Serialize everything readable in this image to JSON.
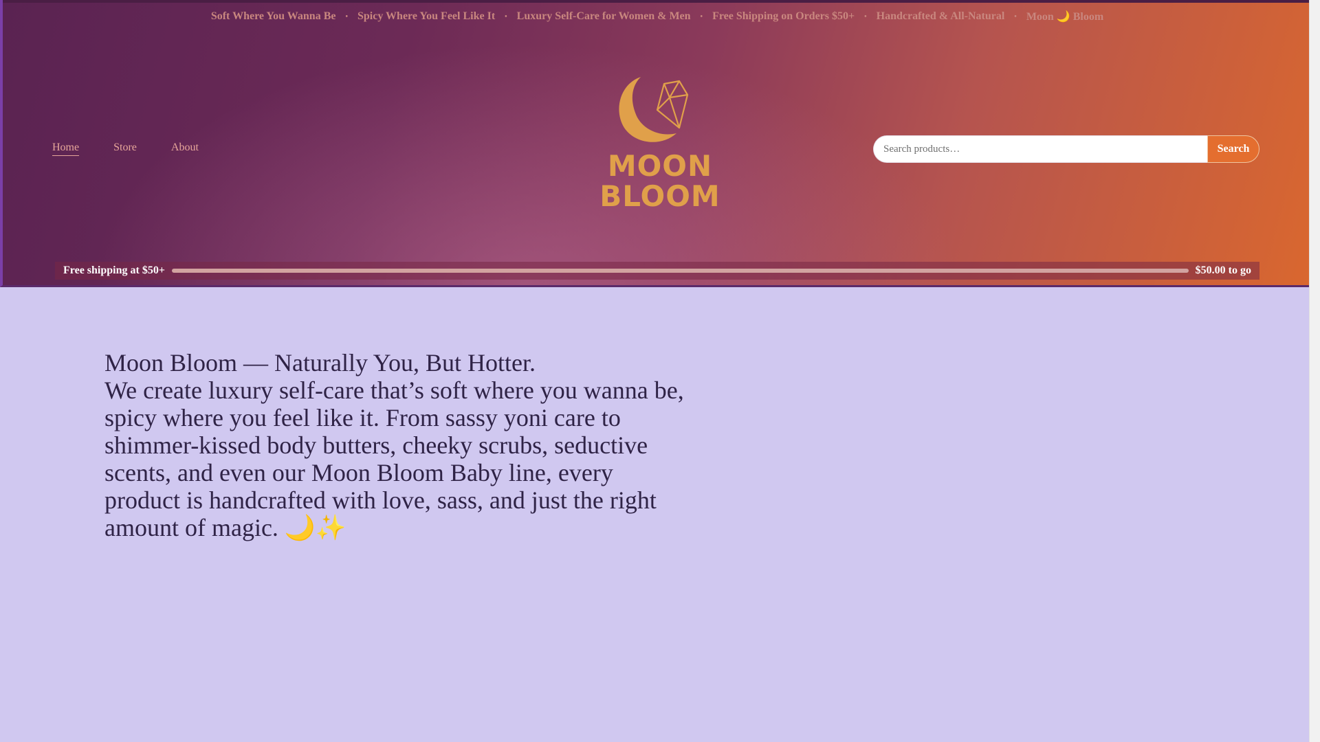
{
  "ticker": {
    "items": [
      "Soft Where You Wanna Be",
      "Spicy Where You Feel Like It",
      "Luxury Self-Care for Women & Men",
      "Free Shipping on Orders $50+",
      "Handcrafted & All-Natural",
      "Moon 🌙 Bloom"
    ]
  },
  "nav": {
    "items": [
      {
        "label": "Home",
        "active": true
      },
      {
        "label": "Store",
        "active": false
      },
      {
        "label": "About",
        "active": false
      }
    ]
  },
  "logo": {
    "line1": "MOON",
    "line2": "BLOOM",
    "icon": "moon-crystal-logo-icon",
    "color": "#e0a04a"
  },
  "search": {
    "placeholder": "Search products…",
    "button_label": "Search"
  },
  "shipping": {
    "label": "Free shipping at $50+",
    "remaining": "$50.00 to go",
    "progress": 0
  },
  "hero": {
    "title": "Moon Bloom — Naturally You, But Hotter.",
    "body": "We create luxury self-care that’s soft where you wanna be, spicy where you feel like it. From sassy yoni care to shimmer-kissed body butters, cheeky scrubs, seductive scents, and even our Moon Bloom Baby line, every product is handcrafted with love, sass, and just the right amount of magic. 🌙✨"
  },
  "colors": {
    "accent": "#e46e2f",
    "page_bg": "#d0c8f0",
    "text": "#2f2346"
  }
}
